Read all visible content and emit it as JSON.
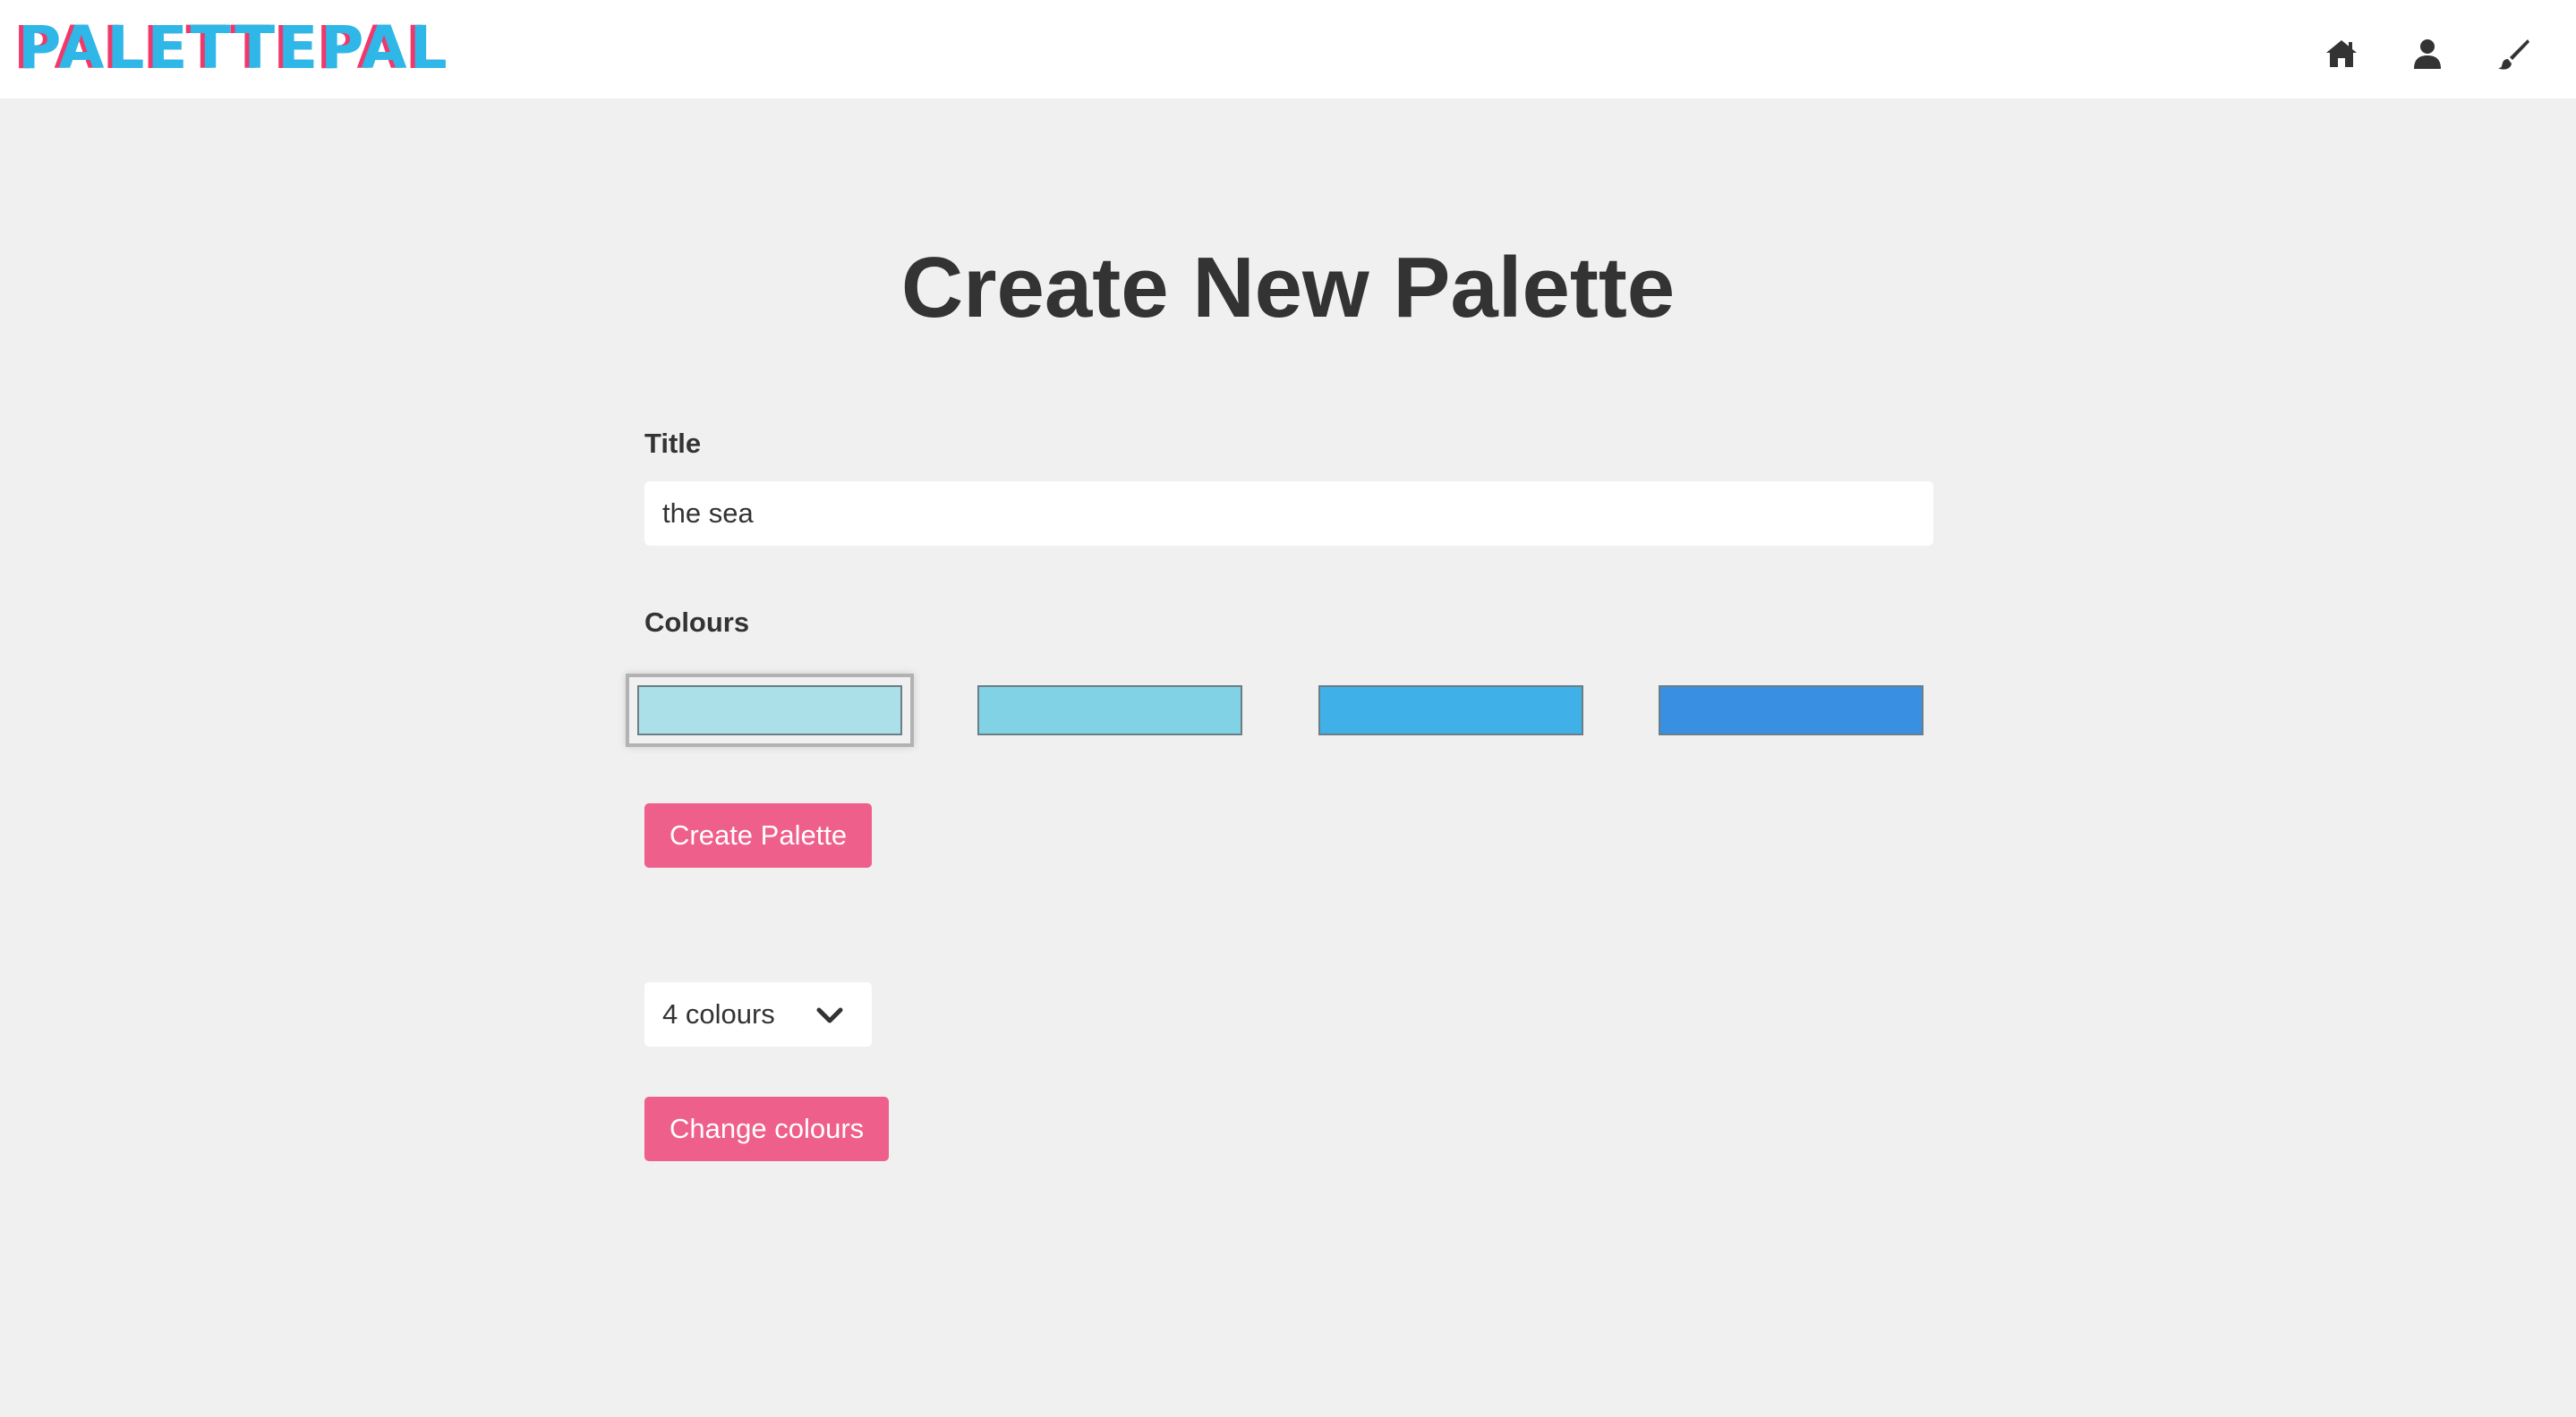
{
  "header": {
    "logo": "PALETTEPAL",
    "icons": [
      "home-icon",
      "user-icon",
      "paintbrush-icon"
    ]
  },
  "main": {
    "title": "Create New Palette",
    "title_label": "Title",
    "title_value": "the sea",
    "colours_label": "Colours",
    "swatches": [
      "#abe0e8",
      "#82d2e6",
      "#40b1e8",
      "#3990e2"
    ],
    "create_button": "Create Palette",
    "colour_count": "4 colours",
    "change_button": "Change colours"
  },
  "colors": {
    "accent": "#ef5f8c",
    "logo_primary": "#2fb7e8",
    "logo_shadow": "#f0386b",
    "background": "#f0f0f0"
  }
}
